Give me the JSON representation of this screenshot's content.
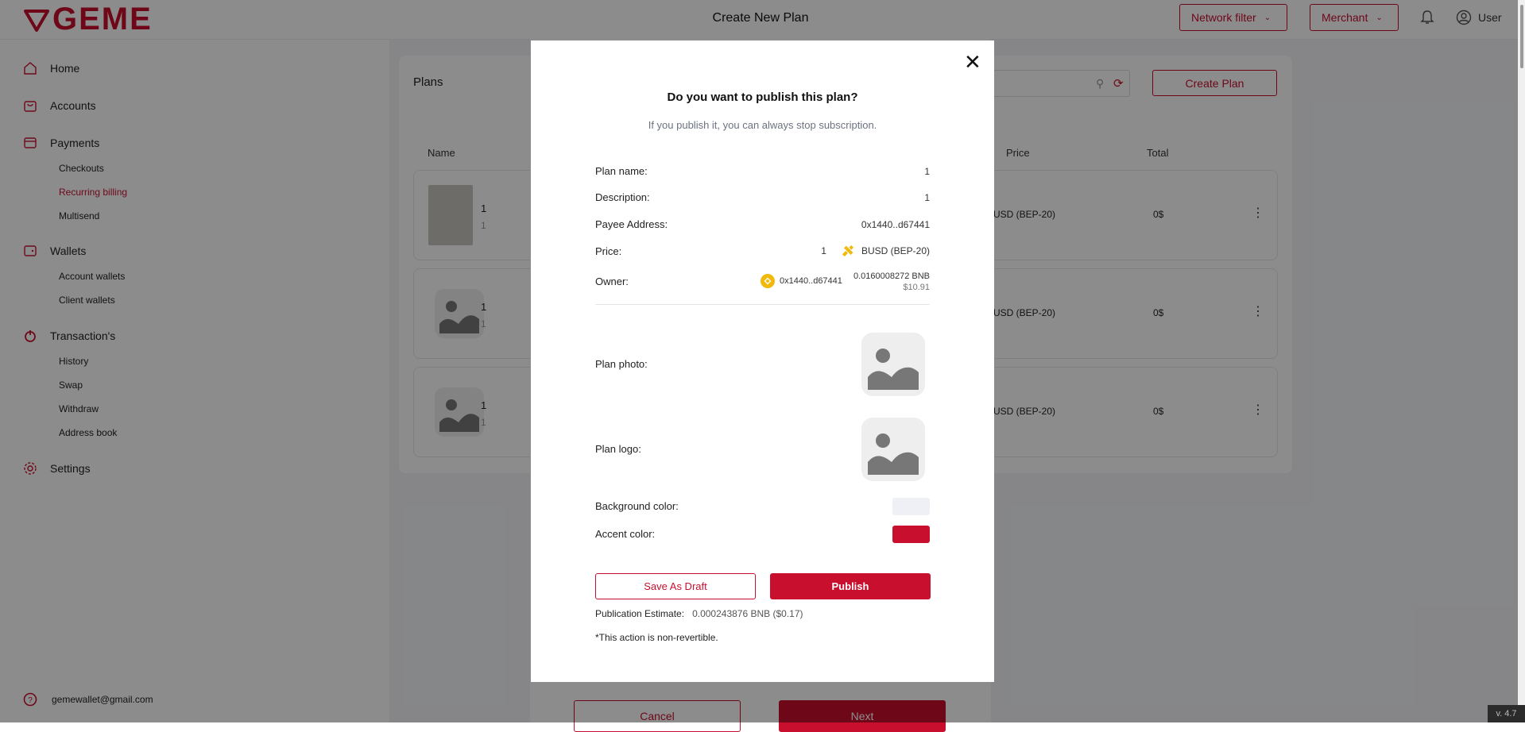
{
  "app": {
    "logo_text": "GEME",
    "network_filter_label": "Network filter",
    "merchant_label": "Merchant",
    "user_label": "User"
  },
  "sidebar": {
    "items": [
      {
        "label": "Home",
        "icon": "home-icon"
      },
      {
        "label": "Accounts",
        "icon": "bag-icon"
      },
      {
        "label": "Payments",
        "icon": "card-icon"
      },
      {
        "label": "Wallets",
        "icon": "wallet-icon"
      },
      {
        "label": "Transaction's",
        "icon": "power-icon"
      },
      {
        "label": "Settings",
        "icon": "gear-icon"
      }
    ],
    "payments_sub": [
      "Checkouts",
      "Recurring billing",
      "Multisend"
    ],
    "wallets_sub": [
      "Account wallets",
      "Client wallets"
    ],
    "transactions_sub": [
      "History",
      "Swap",
      "Withdraw",
      "Address book"
    ],
    "footer_email": "gemewallet@gmail.com"
  },
  "plans": {
    "title": "Plans",
    "create_button": "Create Plan",
    "columns": {
      "name": "Name",
      "price": "Price",
      "total": "Total"
    },
    "rows": [
      {
        "title": "1",
        "subtitle": "1",
        "price": "USD (BEP-20)",
        "total": "0$"
      },
      {
        "title": "1",
        "subtitle": "1",
        "price": "USD (BEP-20)",
        "total": "0$"
      },
      {
        "title": "1",
        "subtitle": "1",
        "price": "USD (BEP-20)",
        "total": "0$"
      }
    ]
  },
  "wizard": {
    "title": "Create New Plan",
    "cancel_label": "Cancel",
    "next_label": "Next"
  },
  "dialog": {
    "title": "Do you want to publish this plan?",
    "subtitle": "If you publish it, you can always stop subscription.",
    "plan_name_label": "Plan name:",
    "plan_name_value": "1",
    "description_label": "Description:",
    "description_value": "1",
    "payee_label": "Payee Address:",
    "payee_value": "0x1440..d67441",
    "price_label": "Price:",
    "price_amount": "1",
    "price_currency": "BUSD (BEP-20)",
    "owner_label": "Owner:",
    "owner_address": "0x1440..d67441",
    "owner_balance": "0.0160008272 BNB",
    "owner_balance_usd": "$10.91",
    "photo_label": "Plan photo:",
    "logo_label": "Plan logo:",
    "bg_color_label": "Background color:",
    "accent_color_label": "Accent color:",
    "bg_color": "#eef0f5",
    "accent_color": "#c8102e",
    "save_draft_label": "Save As Draft",
    "publish_label": "Publish",
    "estimate_label": "Publication Estimate:",
    "estimate_value": "0.000243876 BNB ($0.17)",
    "note": "*This action is non-revertible."
  },
  "version": "v. 4.7",
  "colors": {
    "brand": "#c8102e",
    "overlay": "rgba(0,0,0,0.45)"
  }
}
